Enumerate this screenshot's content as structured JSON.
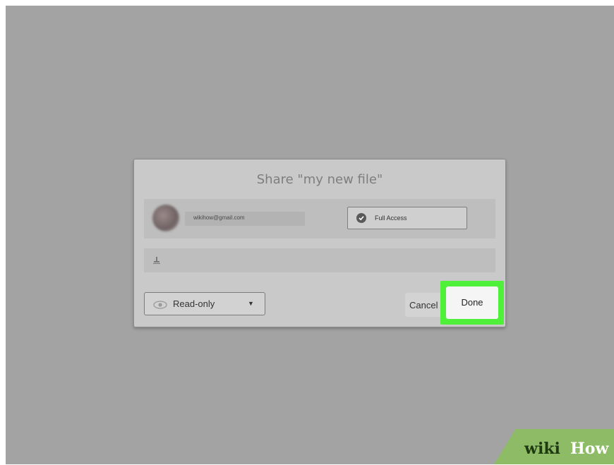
{
  "dialog": {
    "title": "Share \"my new file\""
  },
  "collaborator": {
    "email": "wikihow@gmail.com",
    "access_label": "Full Access"
  },
  "add_user": {
    "icon": "person-add-icon"
  },
  "footer": {
    "permission_label": "Read-only",
    "cancel_label": "Cancel",
    "done_label": "Done"
  },
  "watermark": {
    "part1": "wiki",
    "part2": "How"
  },
  "colors": {
    "background": "#a3a3a3",
    "dialog": "#c9c9c9",
    "highlight": "#4ef03a",
    "watermark": "#8dbb66"
  }
}
